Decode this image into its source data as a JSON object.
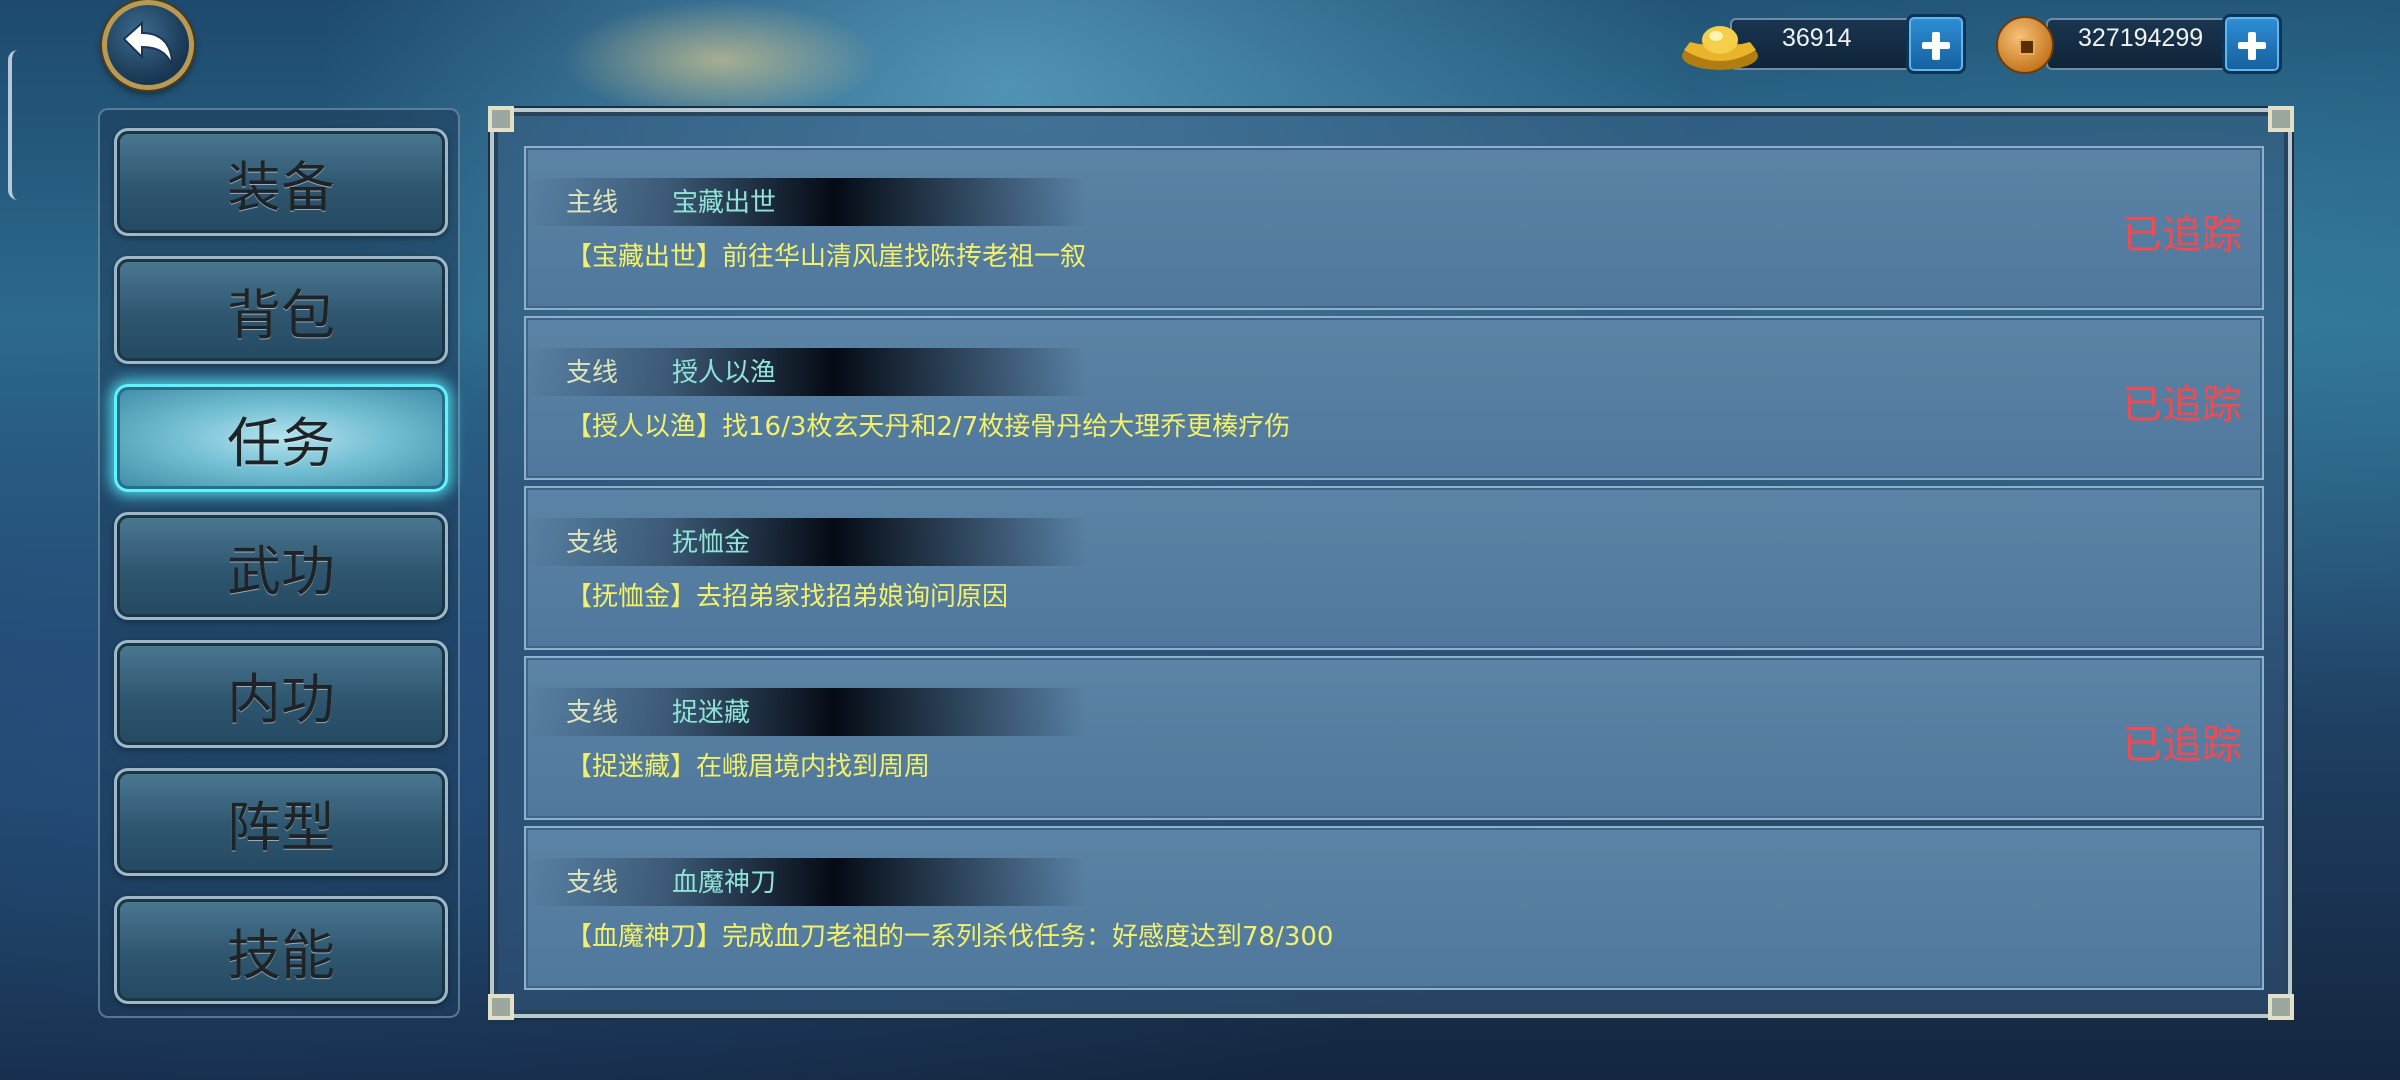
{
  "currencies": {
    "gold": {
      "icon": "gold-ingot-icon",
      "value": "36914"
    },
    "coin": {
      "icon": "copper-coin-icon",
      "value": "327194299"
    }
  },
  "menu": {
    "items": [
      {
        "label": "装备",
        "active": false
      },
      {
        "label": "背包",
        "active": false
      },
      {
        "label": "任务",
        "active": true
      },
      {
        "label": "武功",
        "active": false
      },
      {
        "label": "内功",
        "active": false
      },
      {
        "label": "阵型",
        "active": false
      },
      {
        "label": "技能",
        "active": false
      }
    ]
  },
  "quests": [
    {
      "type": "主线",
      "name": "宝藏出世",
      "desc": "【宝藏出世】前往华山清风崖找陈抟老祖一叙",
      "status": "已追踪"
    },
    {
      "type": "支线",
      "name": "授人以渔",
      "desc": "【授人以渔】找16/3枚玄天丹和2/7枚接骨丹给大理乔更楱疗伤",
      "status": "已追踪"
    },
    {
      "type": "支线",
      "name": "抚恤金",
      "desc": "【抚恤金】去招弟家找招弟娘询问原因",
      "status": ""
    },
    {
      "type": "支线",
      "name": "捉迷藏",
      "desc": "【捉迷藏】在峨眉境内找到周周",
      "status": "已追踪"
    },
    {
      "type": "支线",
      "name": "血魔神刀",
      "desc": "【血魔神刀】完成血刀老祖的一系列杀伐任务：好感度达到78/300",
      "status": ""
    }
  ],
  "colors": {
    "accent_active": "#5ef3ff",
    "status_tracked": "#f04a52",
    "quest_desc": "#f3f06a",
    "quest_name": "#8fe4d7"
  }
}
